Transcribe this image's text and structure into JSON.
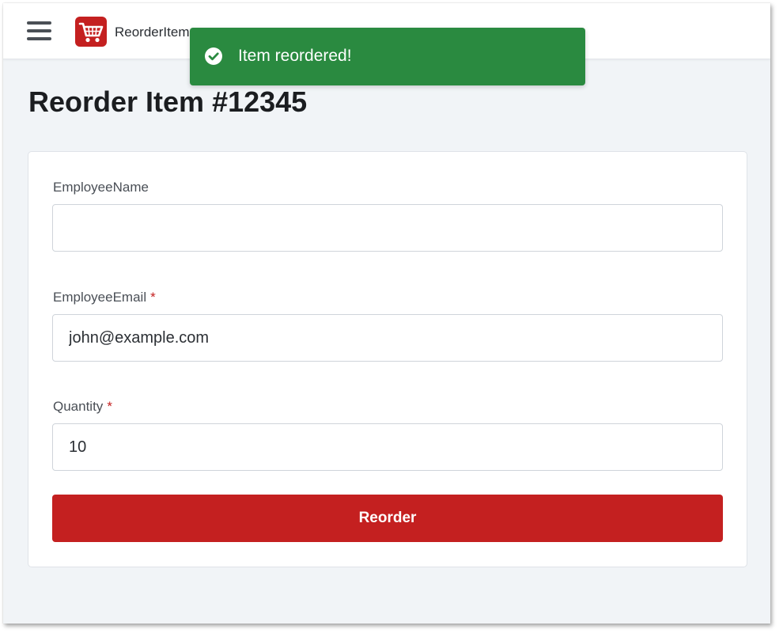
{
  "header": {
    "app_name": "ReorderItem",
    "logo_icon": "shopping-cart-icon",
    "menu_icon": "hamburger-menu-icon"
  },
  "toast": {
    "message": "Item reordered!",
    "icon": "check-circle-icon",
    "color": "#2a8a40"
  },
  "page": {
    "title": "Reorder Item #12345"
  },
  "form": {
    "fields": [
      {
        "label": "EmployeeName",
        "required": false,
        "value": "",
        "placeholder": ""
      },
      {
        "label": "EmployeeEmail",
        "required": true,
        "value": "john@example.com",
        "placeholder": ""
      },
      {
        "label": "Quantity",
        "required": true,
        "value": "10",
        "placeholder": ""
      }
    ],
    "required_marker": "*",
    "submit_label": "Reorder"
  },
  "colors": {
    "accent": "#c42020",
    "success": "#2a8a40",
    "background": "#f1f4f7"
  }
}
